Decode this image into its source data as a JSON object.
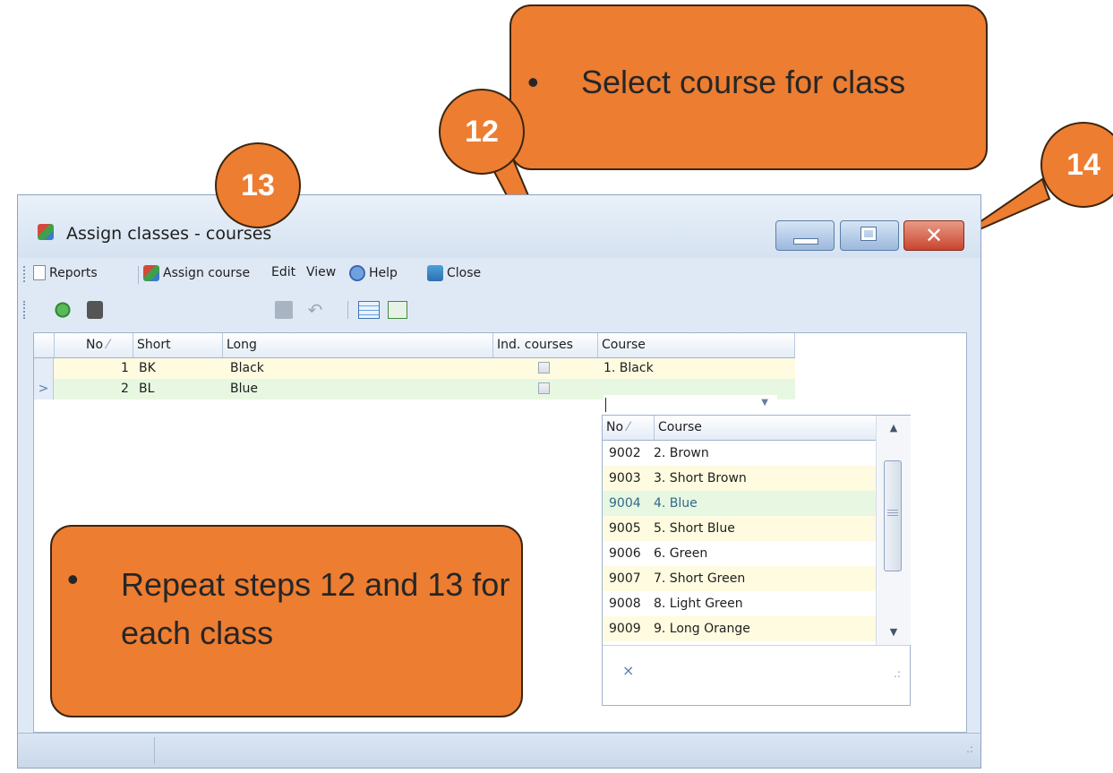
{
  "window": {
    "title": "Assign classes - courses",
    "controls": {
      "minimize": "minimize",
      "maximize": "maximize",
      "close": "✕"
    }
  },
  "menu": {
    "reports": "Reports",
    "assign_course": "Assign course",
    "edit": "Edit",
    "view": "View",
    "help": "Help",
    "close": "Close"
  },
  "toolbar": {
    "search_value": "",
    "icons": [
      "refresh-icon",
      "find-icon",
      "save-icon",
      "undo-icon",
      "grid-icon",
      "grid-refresh-icon"
    ]
  },
  "grid": {
    "columns": {
      "no": "No",
      "short": "Short",
      "long": "Long",
      "ind_courses": "Ind. courses",
      "course": "Course"
    },
    "rows": [
      {
        "no": "1",
        "short": "BK",
        "long": "Black",
        "ind_courses": false,
        "course": "1. Black"
      },
      {
        "no": "2",
        "short": "BL",
        "long": "Blue",
        "ind_courses": false,
        "course": ""
      }
    ]
  },
  "dropdown": {
    "columns": {
      "no": "No",
      "course": "Course"
    },
    "items": [
      {
        "no": "9002",
        "course": "2. Brown"
      },
      {
        "no": "9003",
        "course": "3. Short Brown"
      },
      {
        "no": "9004",
        "course": "4. Blue"
      },
      {
        "no": "9005",
        "course": "5. Short Blue"
      },
      {
        "no": "9006",
        "course": "6. Green"
      },
      {
        "no": "9007",
        "course": "7. Short Green"
      },
      {
        "no": "9008",
        "course": "8. Light Green"
      },
      {
        "no": "9009",
        "course": "9. Long Orange"
      }
    ],
    "clear_symbol": "×"
  },
  "annotations": {
    "callout_top": "Select course for class",
    "callout_bottom": "Repeat steps 12 and 13 for each class",
    "bullet": "•",
    "badges": {
      "step12": "12",
      "step13": "13",
      "step14": "14"
    }
  },
  "colors": {
    "callout": "#ed7d31",
    "row_alt": "#fffbe0",
    "row_selected": "#e8f7e1",
    "close_button": "#c8452e"
  }
}
